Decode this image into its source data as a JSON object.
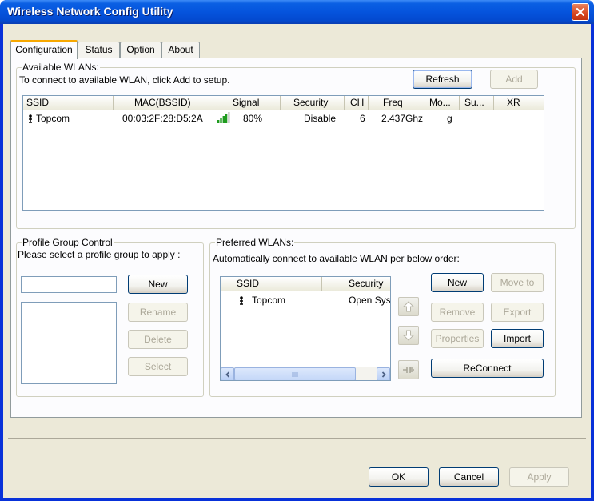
{
  "window": {
    "title": "Wireless Network Config Utility"
  },
  "tabs": [
    {
      "label": "Configuration"
    },
    {
      "label": "Status"
    },
    {
      "label": "Option"
    },
    {
      "label": "About"
    }
  ],
  "available": {
    "legend": "Available WLANs:",
    "instruction": "To connect to available WLAN, click Add to setup.",
    "refresh_label": "Refresh",
    "add_label": "Add",
    "columns": [
      "SSID",
      "MAC(BSSID)",
      "Signal",
      "Security",
      "CH",
      "Freq",
      "Mo...",
      "Su...",
      "XR"
    ],
    "rows": [
      {
        "ssid": "Topcom",
        "mac": "00:03:2F:28:D5:2A",
        "signal": "80%",
        "signal_level": 0.8,
        "security": "Disable",
        "ch": "6",
        "freq": "2.437Ghz",
        "mode": "g",
        "su": "",
        "xr": ""
      }
    ]
  },
  "profile": {
    "legend": "Profile Group Control",
    "instruction": "Please select a profile group to apply :",
    "name_value": "",
    "new_label": "New",
    "rename_label": "Rename",
    "delete_label": "Delete",
    "select_label": "Select"
  },
  "preferred": {
    "legend": "Preferred WLANs:",
    "instruction": "Automatically connect to available WLAN per below order:",
    "columns": [
      "SSID",
      "Security"
    ],
    "rows": [
      {
        "ssid": "Topcom",
        "security": "Open Syst"
      }
    ],
    "new_label": "New",
    "move_to_label": "Move to",
    "remove_label": "Remove",
    "export_label": "Export",
    "properties_label": "Properties",
    "import_label": "Import",
    "reconnect_label": "ReConnect"
  },
  "footer": {
    "ok_label": "OK",
    "cancel_label": "Cancel",
    "apply_label": "Apply"
  }
}
